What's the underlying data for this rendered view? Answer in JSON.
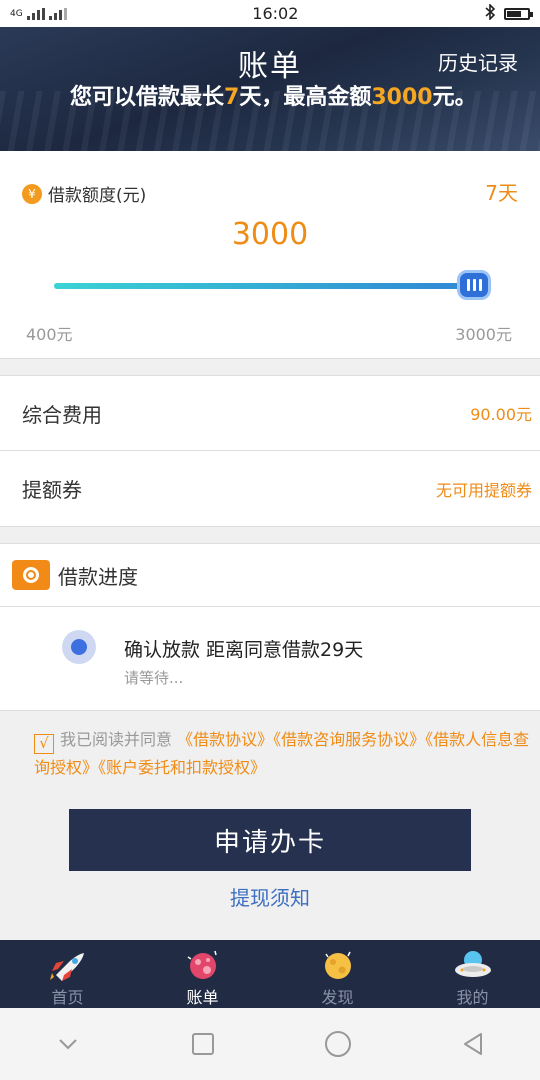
{
  "status_bar": {
    "network": "4G",
    "time": "16:02"
  },
  "header": {
    "title": "账单",
    "history": "历史记录",
    "marquee_prefix": "您可以借款最长",
    "marquee_days": "7",
    "marquee_mid": "天，最高金额",
    "marquee_amount": "3000",
    "marquee_suffix": "元。"
  },
  "loan": {
    "label": "借款额度(元)",
    "yuan_symbol": "¥",
    "days": "7天",
    "amount": "3000",
    "min_label": "400元",
    "max_label": "3000元",
    "min": 400,
    "max": 3000,
    "value": 3000
  },
  "fee": {
    "label": "综合费用",
    "value": "90.00元"
  },
  "coupon": {
    "label": "提额券",
    "value": "无可用提额券"
  },
  "progress": {
    "title": "借款进度",
    "step_title": "确认放款 距离同意借款29天",
    "step_sub": "请等待..."
  },
  "agreement": {
    "check": "√",
    "prefix": "我已阅读并同意",
    "link1": "《借款协议》",
    "link2": "《借款咨询服务协议》",
    "link3": "《借款人信息查询授权》",
    "link4": "《账户委托和扣款授权》"
  },
  "apply_button": "申请办卡",
  "notice_link": "提现须知",
  "tabs": [
    {
      "label": "首页",
      "icon": "rocket-icon"
    },
    {
      "label": "账单",
      "icon": "planet-icon"
    },
    {
      "label": "发现",
      "icon": "moon-icon"
    },
    {
      "label": "我的",
      "icon": "ufo-icon"
    }
  ],
  "colors": {
    "accent": "#ef8c16",
    "header": "#26314f",
    "link": "#3e6fc2"
  }
}
